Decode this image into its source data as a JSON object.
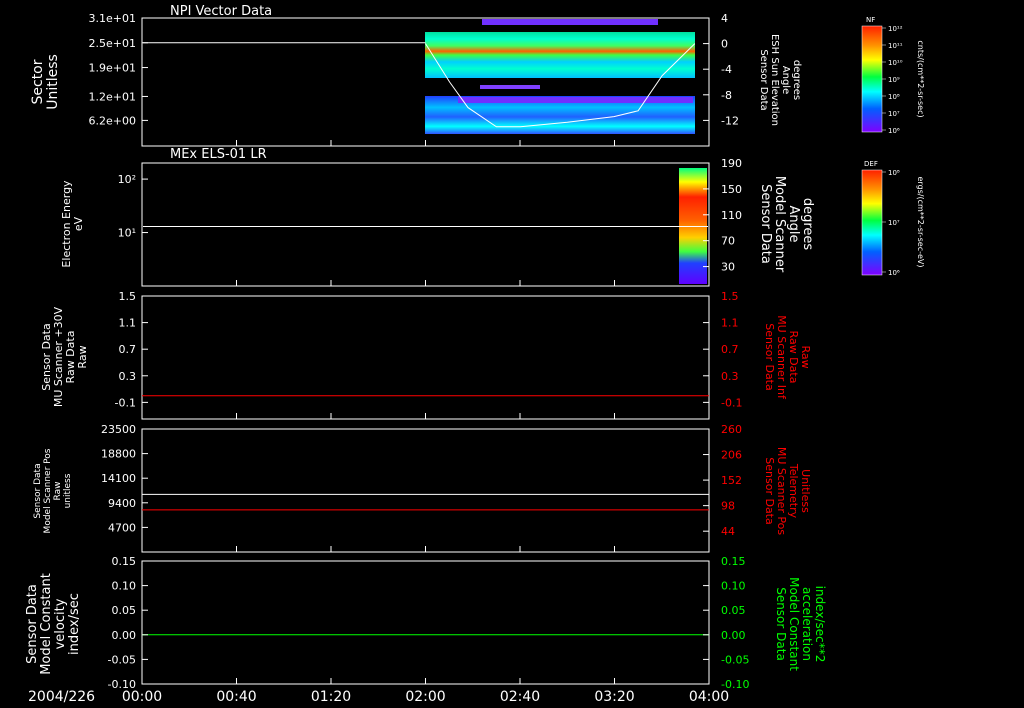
{
  "date_label": "2004/226",
  "time_axis": {
    "ticks": [
      "00:00",
      "00:40",
      "01:20",
      "02:00",
      "02:40",
      "03:20",
      "04:00"
    ],
    "start": "00:00",
    "end": "04:00"
  },
  "colors": {
    "background": "#000000",
    "frame": "#ffffff",
    "red": "#ff0000",
    "green": "#00ff00"
  },
  "colorbars": {
    "top": {
      "tag": "NF",
      "ticks": [
        "10¹²",
        "10¹¹",
        "10¹⁰",
        "10⁹",
        "10⁸",
        "10⁷",
        "10⁶"
      ],
      "unit": "cnts/(cm**2-sr-sec)"
    },
    "bottom": {
      "tag": "DEF",
      "ticks": [
        "10⁸",
        "10⁷",
        "10⁶"
      ],
      "unit": "ergs/(cm**2-sr-sec-eV)"
    }
  },
  "chart_data": [
    {
      "type": "heatmap",
      "title": "NPI Vector Data",
      "left_axis": {
        "label_lines": [
          "Sector",
          "Unitless"
        ],
        "ticks": [
          "3.1e+01",
          "2.5e+01",
          "1.9e+01",
          "1.2e+01",
          "6.2e+00"
        ],
        "tick_values": [
          31,
          25,
          19,
          12,
          6.2
        ],
        "ylim": [
          0,
          31
        ]
      },
      "right_axis": {
        "label_lines": [
          "Sensor Data",
          "ESH Sun Elevation",
          "Angle",
          "degrees"
        ],
        "ticks": [
          "4",
          "0",
          "-4",
          "-8",
          "-12"
        ],
        "tick_values": [
          4,
          0,
          -4,
          -8,
          -12
        ],
        "ylim": [
          -16,
          4
        ]
      },
      "spectrogram_time_range": [
        "02:00",
        "03:55"
      ],
      "line_left_value": 25,
      "elevation_curve": {
        "x_hours": [
          2.0,
          2.17,
          2.3,
          2.5,
          2.67,
          3.0,
          3.33,
          3.5,
          3.67,
          3.9
        ],
        "y": [
          0,
          -6,
          -10,
          -13,
          -13,
          -12.3,
          -11.4,
          -10.5,
          -5,
          0
        ]
      }
    },
    {
      "type": "heatmap",
      "title": "MEx ELS-01 LR",
      "left_axis": {
        "label_lines": [
          "Electron Energy",
          "eV"
        ],
        "ticks": [
          "10²",
          "10¹"
        ],
        "tick_values": [
          100,
          10
        ],
        "scale": "log",
        "ylim": [
          1,
          200
        ]
      },
      "right_axis": {
        "label_lines": [
          "Sensor Data",
          "Model Scanner",
          "Angle",
          "degrees"
        ],
        "ticks": [
          "190",
          "150",
          "110",
          "70",
          "30"
        ],
        "tick_values": [
          190,
          150,
          110,
          70,
          30
        ],
        "ylim": [
          0,
          190
        ]
      },
      "spectrogram_time_range": [
        "03:53",
        "04:00"
      ],
      "line_right_value": 92
    },
    {
      "type": "line",
      "left_axis": {
        "label_lines": [
          "Sensor Data",
          "MU Scanner +30V",
          "Raw Data",
          "Raw"
        ],
        "ticks": [
          "1.5",
          "1.1",
          "0.7",
          "0.3",
          "-0.1"
        ],
        "tick_values": [
          1.5,
          1.1,
          0.7,
          0.3,
          -0.1
        ],
        "ylim": [
          -0.35,
          1.5
        ]
      },
      "right_axis": {
        "label_lines": [
          "Sensor Data",
          "MU Scanner Inf",
          "Raw Data",
          "Raw"
        ],
        "ticks": [
          "1.5",
          "1.1",
          "0.7",
          "0.3",
          "-0.1"
        ],
        "tick_values": [
          1.5,
          1.1,
          0.7,
          0.3,
          -0.1
        ],
        "ylim": [
          -0.35,
          1.5
        ],
        "color": "red"
      },
      "series": [
        {
          "name": "MU Scanner Inf",
          "color": "red",
          "x_hours": [
            0,
            4
          ],
          "y": [
            0.0,
            0.0
          ]
        }
      ]
    },
    {
      "type": "line",
      "left_axis": {
        "label_lines": [
          "Sensor Data",
          "Model Scanner Pos",
          "Raw",
          "unitless"
        ],
        "ticks": [
          "23500",
          "18800",
          "14100",
          "9400",
          "4700"
        ],
        "tick_values": [
          23500,
          18800,
          14100,
          9400,
          4700
        ],
        "ylim": [
          0,
          23500
        ]
      },
      "right_axis": {
        "label_lines": [
          "Sensor Data",
          "MU Scanner Pos",
          "Telemetry",
          "Unitless"
        ],
        "ticks": [
          "260",
          "206",
          "152",
          "98",
          "44"
        ],
        "tick_values": [
          260,
          206,
          152,
          98,
          44
        ],
        "ylim": [
          0,
          260
        ],
        "color": "red"
      },
      "series": [
        {
          "name": "Model Scanner Pos",
          "color": "white",
          "x_hours": [
            0,
            4
          ],
          "y": [
            11000,
            11000
          ]
        },
        {
          "name": "MU Scanner Pos",
          "color": "red",
          "x_hours": [
            0,
            4
          ],
          "y": [
            89,
            89
          ]
        }
      ]
    },
    {
      "type": "line",
      "left_axis": {
        "label_lines": [
          "Sensor Data",
          "Model Constant",
          "velocity",
          "index/sec"
        ],
        "ticks": [
          "0.15",
          "0.10",
          "0.05",
          "0.00",
          "-0.05",
          "-0.10"
        ],
        "tick_values": [
          0.15,
          0.1,
          0.05,
          0.0,
          -0.05,
          -0.1
        ],
        "ylim": [
          -0.1,
          0.15
        ]
      },
      "right_axis": {
        "label_lines": [
          "Sensor Data",
          "Model Constant",
          "acceleration",
          "index/sec**2"
        ],
        "ticks": [
          "0.15",
          "0.10",
          "0.05",
          "0.00",
          "-0.05",
          "-0.10"
        ],
        "tick_values": [
          0.15,
          0.1,
          0.05,
          0.0,
          -0.05,
          -0.1
        ],
        "ylim": [
          -0.1,
          0.15
        ],
        "color": "green"
      },
      "series": [
        {
          "name": "Model Constant acceleration",
          "color": "green",
          "x_hours": [
            0,
            4
          ],
          "y": [
            0.0,
            0.0
          ]
        }
      ]
    }
  ]
}
